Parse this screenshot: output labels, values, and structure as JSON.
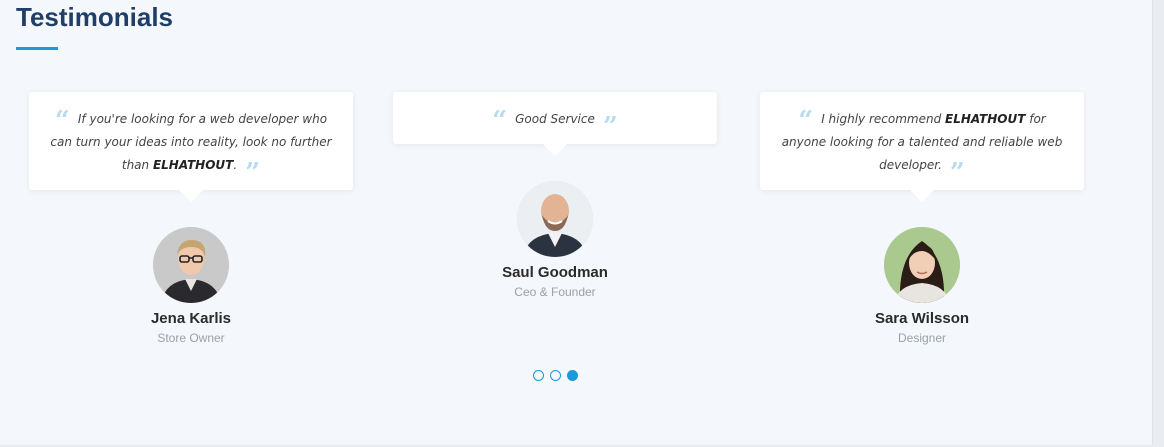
{
  "section": {
    "title": "Testimonials"
  },
  "testimonials": [
    {
      "quote_pre": "If you're looking for a web developer who can turn your ideas into reality, look no further than ",
      "quote_bold": "ELHATHOUT",
      "quote_post": ".",
      "name": "Jena Karlis",
      "role": "Store Owner"
    },
    {
      "quote_pre": "Good Service",
      "quote_bold": "",
      "quote_post": "",
      "name": "Saul Goodman",
      "role": "Ceo & Founder"
    },
    {
      "quote_pre": "I highly recommend ",
      "quote_bold": "ELHATHOUT",
      "quote_post": " for anyone looking for a talented and reliable web developer.",
      "name": "Sara Wilsson",
      "role": "Designer"
    }
  ],
  "carousel": {
    "slide_count": 3,
    "active_index": 2
  },
  "colors": {
    "accent": "#1a9ad9",
    "title": "#1f3f68",
    "quote_mark": "#b7dcf2",
    "background": "#f4f7fb"
  }
}
